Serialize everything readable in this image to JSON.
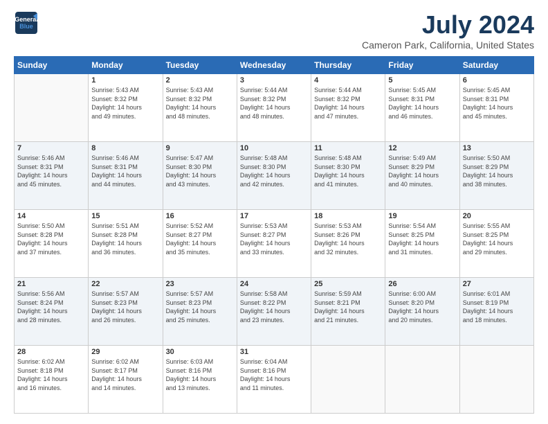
{
  "logo": {
    "line1": "General",
    "line2": "Blue"
  },
  "title": "July 2024",
  "location": "Cameron Park, California, United States",
  "weekdays": [
    "Sunday",
    "Monday",
    "Tuesday",
    "Wednesday",
    "Thursday",
    "Friday",
    "Saturday"
  ],
  "weeks": [
    [
      {
        "day": "",
        "info": ""
      },
      {
        "day": "1",
        "info": "Sunrise: 5:43 AM\nSunset: 8:32 PM\nDaylight: 14 hours\nand 49 minutes."
      },
      {
        "day": "2",
        "info": "Sunrise: 5:43 AM\nSunset: 8:32 PM\nDaylight: 14 hours\nand 48 minutes."
      },
      {
        "day": "3",
        "info": "Sunrise: 5:44 AM\nSunset: 8:32 PM\nDaylight: 14 hours\nand 48 minutes."
      },
      {
        "day": "4",
        "info": "Sunrise: 5:44 AM\nSunset: 8:32 PM\nDaylight: 14 hours\nand 47 minutes."
      },
      {
        "day": "5",
        "info": "Sunrise: 5:45 AM\nSunset: 8:31 PM\nDaylight: 14 hours\nand 46 minutes."
      },
      {
        "day": "6",
        "info": "Sunrise: 5:45 AM\nSunset: 8:31 PM\nDaylight: 14 hours\nand 45 minutes."
      }
    ],
    [
      {
        "day": "7",
        "info": "Sunrise: 5:46 AM\nSunset: 8:31 PM\nDaylight: 14 hours\nand 45 minutes."
      },
      {
        "day": "8",
        "info": "Sunrise: 5:46 AM\nSunset: 8:31 PM\nDaylight: 14 hours\nand 44 minutes."
      },
      {
        "day": "9",
        "info": "Sunrise: 5:47 AM\nSunset: 8:30 PM\nDaylight: 14 hours\nand 43 minutes."
      },
      {
        "day": "10",
        "info": "Sunrise: 5:48 AM\nSunset: 8:30 PM\nDaylight: 14 hours\nand 42 minutes."
      },
      {
        "day": "11",
        "info": "Sunrise: 5:48 AM\nSunset: 8:30 PM\nDaylight: 14 hours\nand 41 minutes."
      },
      {
        "day": "12",
        "info": "Sunrise: 5:49 AM\nSunset: 8:29 PM\nDaylight: 14 hours\nand 40 minutes."
      },
      {
        "day": "13",
        "info": "Sunrise: 5:50 AM\nSunset: 8:29 PM\nDaylight: 14 hours\nand 38 minutes."
      }
    ],
    [
      {
        "day": "14",
        "info": "Sunrise: 5:50 AM\nSunset: 8:28 PM\nDaylight: 14 hours\nand 37 minutes."
      },
      {
        "day": "15",
        "info": "Sunrise: 5:51 AM\nSunset: 8:28 PM\nDaylight: 14 hours\nand 36 minutes."
      },
      {
        "day": "16",
        "info": "Sunrise: 5:52 AM\nSunset: 8:27 PM\nDaylight: 14 hours\nand 35 minutes."
      },
      {
        "day": "17",
        "info": "Sunrise: 5:53 AM\nSunset: 8:27 PM\nDaylight: 14 hours\nand 33 minutes."
      },
      {
        "day": "18",
        "info": "Sunrise: 5:53 AM\nSunset: 8:26 PM\nDaylight: 14 hours\nand 32 minutes."
      },
      {
        "day": "19",
        "info": "Sunrise: 5:54 AM\nSunset: 8:25 PM\nDaylight: 14 hours\nand 31 minutes."
      },
      {
        "day": "20",
        "info": "Sunrise: 5:55 AM\nSunset: 8:25 PM\nDaylight: 14 hours\nand 29 minutes."
      }
    ],
    [
      {
        "day": "21",
        "info": "Sunrise: 5:56 AM\nSunset: 8:24 PM\nDaylight: 14 hours\nand 28 minutes."
      },
      {
        "day": "22",
        "info": "Sunrise: 5:57 AM\nSunset: 8:23 PM\nDaylight: 14 hours\nand 26 minutes."
      },
      {
        "day": "23",
        "info": "Sunrise: 5:57 AM\nSunset: 8:23 PM\nDaylight: 14 hours\nand 25 minutes."
      },
      {
        "day": "24",
        "info": "Sunrise: 5:58 AM\nSunset: 8:22 PM\nDaylight: 14 hours\nand 23 minutes."
      },
      {
        "day": "25",
        "info": "Sunrise: 5:59 AM\nSunset: 8:21 PM\nDaylight: 14 hours\nand 21 minutes."
      },
      {
        "day": "26",
        "info": "Sunrise: 6:00 AM\nSunset: 8:20 PM\nDaylight: 14 hours\nand 20 minutes."
      },
      {
        "day": "27",
        "info": "Sunrise: 6:01 AM\nSunset: 8:19 PM\nDaylight: 14 hours\nand 18 minutes."
      }
    ],
    [
      {
        "day": "28",
        "info": "Sunrise: 6:02 AM\nSunset: 8:18 PM\nDaylight: 14 hours\nand 16 minutes."
      },
      {
        "day": "29",
        "info": "Sunrise: 6:02 AM\nSunset: 8:17 PM\nDaylight: 14 hours\nand 14 minutes."
      },
      {
        "day": "30",
        "info": "Sunrise: 6:03 AM\nSunset: 8:16 PM\nDaylight: 14 hours\nand 13 minutes."
      },
      {
        "day": "31",
        "info": "Sunrise: 6:04 AM\nSunset: 8:16 PM\nDaylight: 14 hours\nand 11 minutes."
      },
      {
        "day": "",
        "info": ""
      },
      {
        "day": "",
        "info": ""
      },
      {
        "day": "",
        "info": ""
      }
    ]
  ]
}
